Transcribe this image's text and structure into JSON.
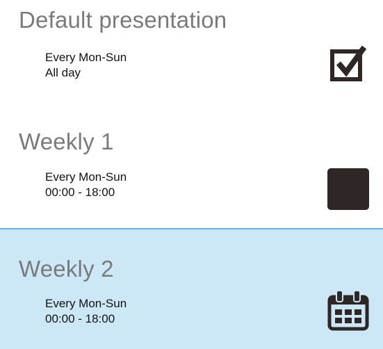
{
  "items": [
    {
      "title": "Default presentation",
      "schedule_days": "Every Mon-Sun",
      "schedule_time": "All day",
      "icon": "checked-checkbox-icon",
      "selected": false
    },
    {
      "title": "Weekly 1",
      "schedule_days": "Every Mon-Sun",
      "schedule_time": "00:00 - 18:00",
      "icon": "filled-square-icon",
      "selected": false
    },
    {
      "title": "Weekly 2",
      "schedule_days": "Every Mon-Sun",
      "schedule_time": "00:00 - 18:00",
      "icon": "calendar-icon",
      "selected": true
    }
  ],
  "colors": {
    "selected_background": "#cce8f6",
    "selected_border": "#5fb3e6",
    "title_text": "#7a7a7a",
    "icon": "#2f2626"
  }
}
